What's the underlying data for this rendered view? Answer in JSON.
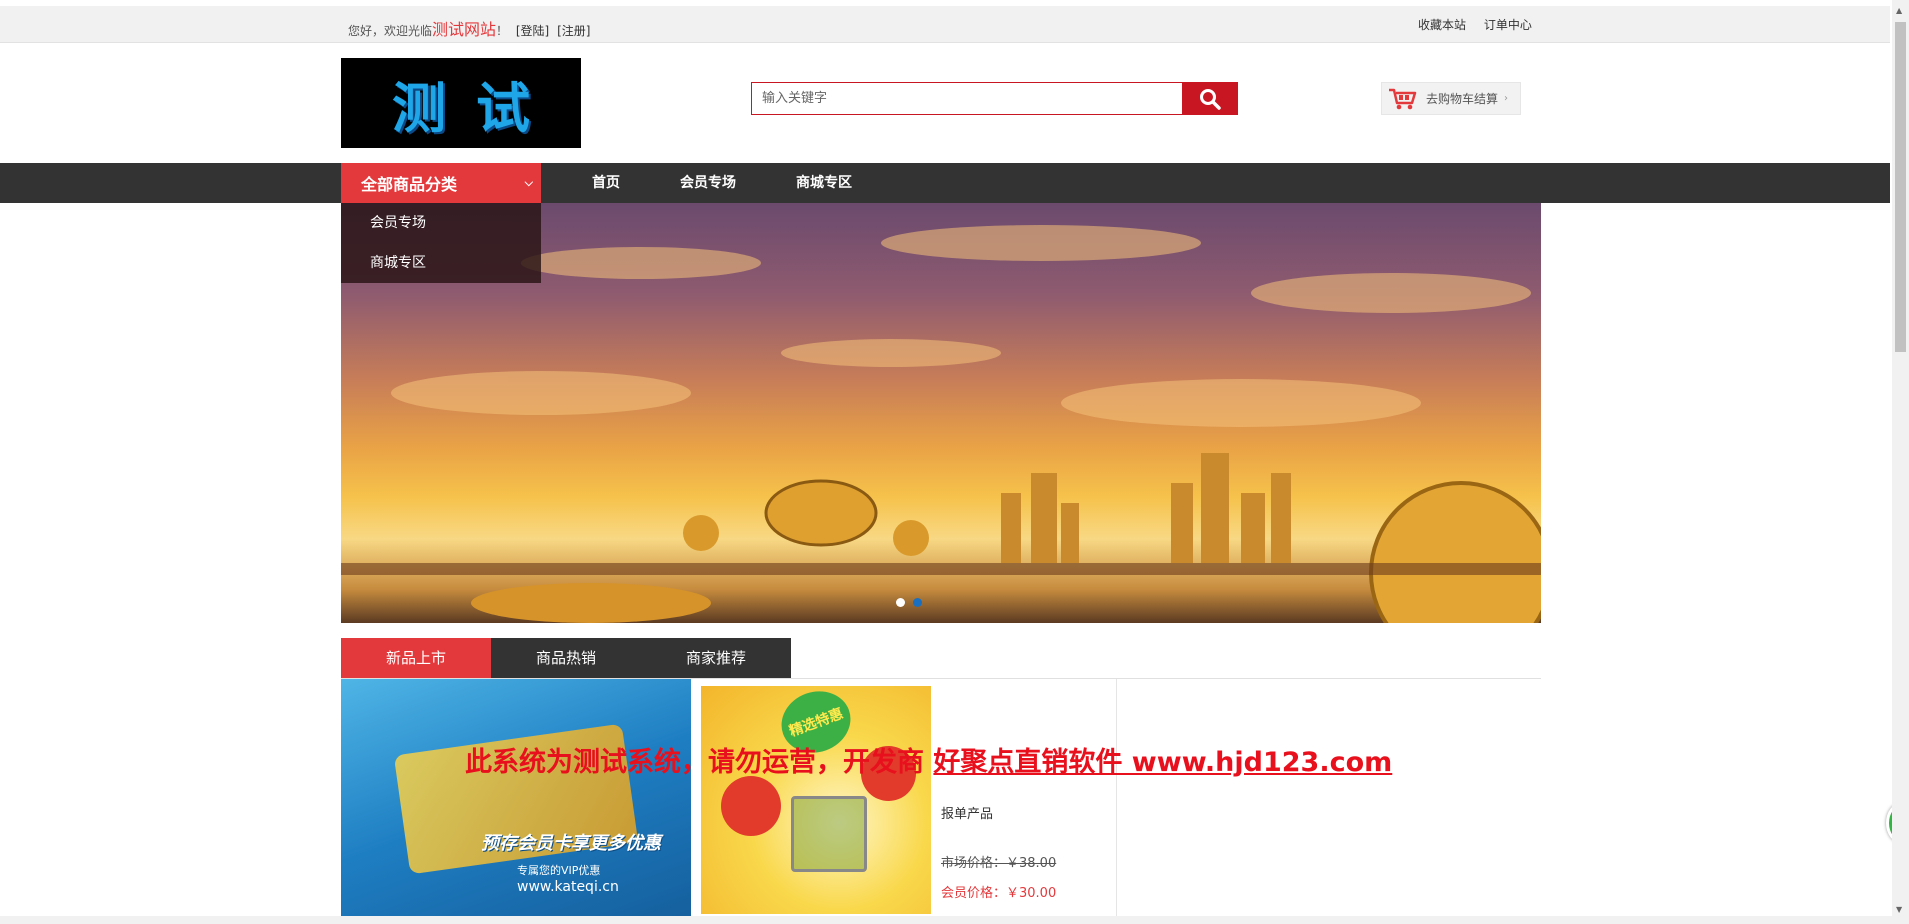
{
  "topbar": {
    "welcome": "您好，欢迎光临",
    "site_name": "测试网站",
    "exclaim": "！",
    "login": "[登陆]",
    "register": "[注册]",
    "favorite": "收藏本站",
    "orders": "订单中心"
  },
  "header": {
    "logo_text": "测试",
    "search_placeholder": "输入关键字",
    "cart_label": "去购物车结算"
  },
  "nav": {
    "all_categories": "全部商品分类",
    "links": [
      "首页",
      "会员专场",
      "商城专区"
    ],
    "category_menu": [
      "会员专场",
      "商城专区"
    ]
  },
  "banner": {
    "slide_count": 2,
    "active_slide": 2
  },
  "tabs": [
    "新品上市",
    "商品热销",
    "商家推荐"
  ],
  "products": {
    "card1": {
      "headline": "预存会员卡享更多优惠",
      "sub": "专属您的VIP优惠",
      "url": "www.kateqi.cn"
    },
    "card2": {
      "badge": "精选特惠",
      "name": "报单产品",
      "market_price": "市场价格：￥38.00",
      "member_price": "会员价格：￥30.00"
    }
  },
  "watermark": {
    "text": "此系统为测试系统，请勿运营，开发商 ",
    "link": "好聚点直销软件 www.hjd123.com"
  },
  "float_button": "54",
  "colors": {
    "accent": "#e4393c",
    "nav_bg": "#333333",
    "search_btn": "#c81623",
    "active_dot": "#1a6fc0"
  }
}
